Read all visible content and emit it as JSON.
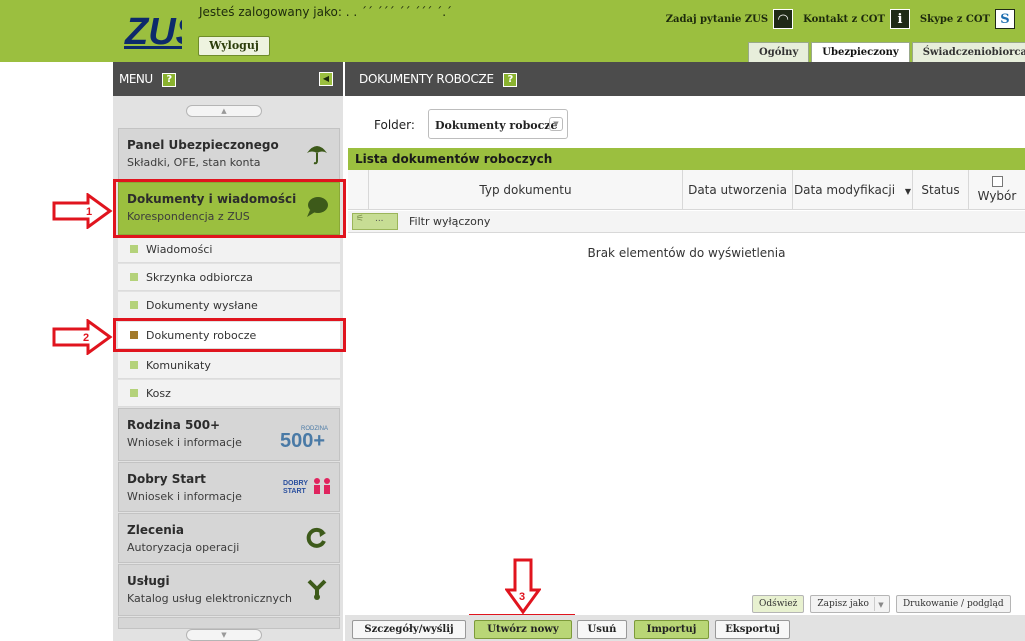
{
  "header": {
    "logo_text": "ZUS",
    "logged_in_label": "Jesteś zalogowany jako: . . ´´ ´´´ ´´ ´´´ ´.´",
    "logout_label": "Wyloguj",
    "links": [
      {
        "label": "Zadaj pytanie ZUS",
        "icon": "headset-icon"
      },
      {
        "label": "Kontakt z COT",
        "icon": "info-icon"
      },
      {
        "label": "Skype z COT",
        "icon": "skype-icon"
      }
    ],
    "tabs": [
      "Ogólny",
      "Ubezpieczony",
      "Świadczeniobiorca"
    ],
    "active_tab": "Ubezpieczony"
  },
  "sidebar": {
    "menu_title": "MENU",
    "help_glyph": "?",
    "groups": [
      {
        "title": "Panel Ubezpieczonego",
        "subtitle": "Składki, OFE, stan konta",
        "icon": "umbrella-icon"
      },
      {
        "title": "Dokumenty i wiadomości",
        "subtitle": "Korespondencja z ZUS",
        "icon": "speech-bubble-icon"
      },
      {
        "title": "Rodzina 500+",
        "subtitle": "Wniosek i informacje",
        "icon": "rodzina-500-logo",
        "logo_word": "RODZINA",
        "logo_number": "500+"
      },
      {
        "title": "Dobry Start",
        "subtitle": "Wniosek i informacje",
        "icon": "dobry-start-logo",
        "logo_word_1": "DOBRY",
        "logo_word_2": "START"
      },
      {
        "title": "Zlecenia",
        "subtitle": "Autoryzacja operacji",
        "icon": "refresh-icon"
      },
      {
        "title": "Usługi",
        "subtitle": "Katalog usług elektronicznych",
        "icon": "services-icon"
      }
    ],
    "sub_items": [
      "Wiadomości",
      "Skrzynka odbiorcza",
      "Dokumenty wysłane",
      "Dokumenty robocze",
      "Komunikaty",
      "Kosz"
    ]
  },
  "annotations": [
    "1",
    "2",
    "3"
  ],
  "main": {
    "title": "DOKUMENTY ROBOCZE",
    "folder_label": "Folder:",
    "folder_value": "Dokumenty robocze",
    "list_title": "Lista dokumentów roboczych",
    "columns": [
      "Typ dokumentu",
      "Data utworzenia",
      "Data modyfikacji",
      "Status",
      "Wybór"
    ],
    "filter_button": "...",
    "filter_text": "Filtr wyłączony",
    "empty_message": "Brak elementów do wyświetlenia",
    "small_buttons": [
      "Odśwież",
      "Zapisz jako",
      "Drukowanie / podgląd"
    ],
    "bottom_buttons": [
      "Szczegóły/wyślij",
      "Utwórz nowy",
      "Usuń",
      "Importuj",
      "Eksportuj"
    ]
  },
  "colors": {
    "brand_green": "#9bbf3f",
    "dark_bar": "#4c4c4c",
    "annotation_red": "#e0141e"
  }
}
